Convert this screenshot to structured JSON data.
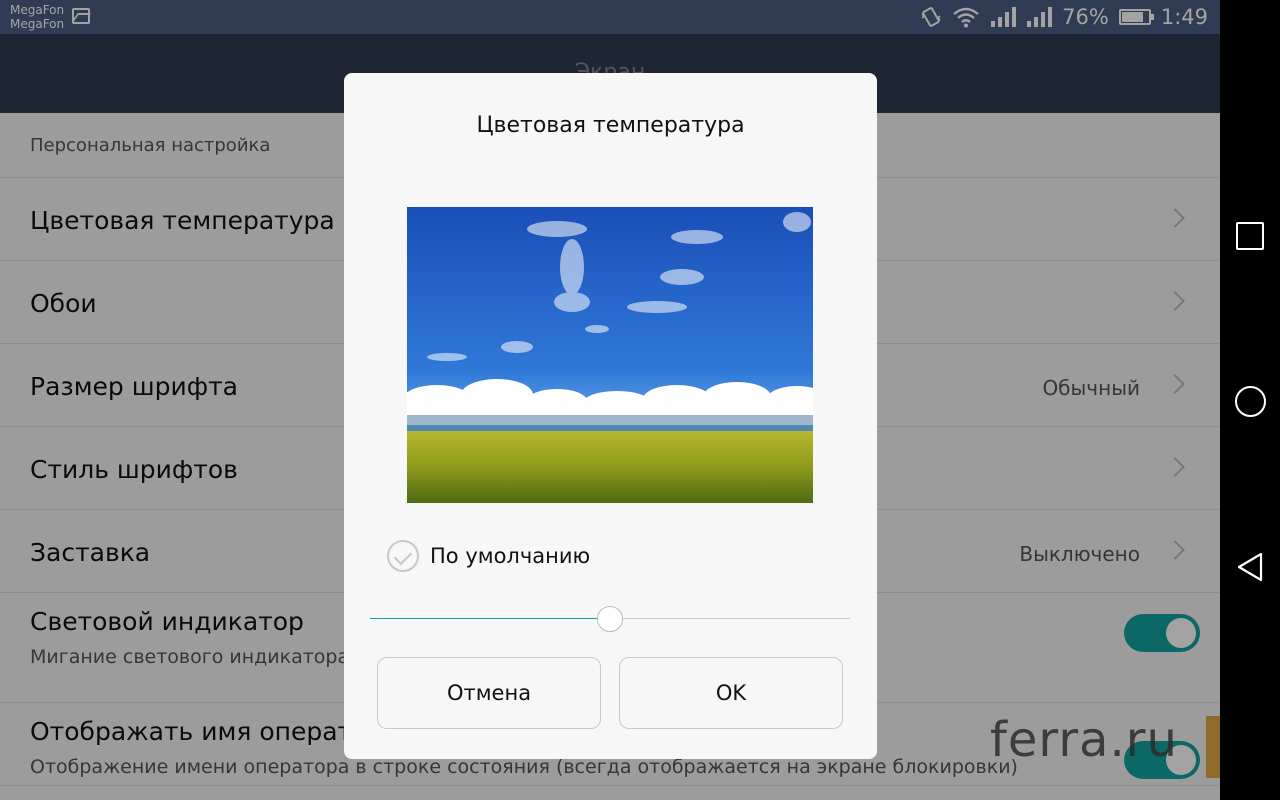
{
  "status_bar": {
    "carrier_1": "MegaFon",
    "carrier_2": "MegaFon",
    "battery": "76%",
    "time": "1:49",
    "icons": [
      "gallery-icon",
      "vibrate-icon",
      "wifi-icon",
      "signal-icon",
      "signal-icon",
      "battery-icon"
    ],
    "battery_level": 0.76
  },
  "app_bar": {
    "title": "Экран"
  },
  "settings": {
    "section_header": "Персональная настройка",
    "items": [
      {
        "title": "Цветовая температура",
        "value": ""
      },
      {
        "title": "Обои",
        "value": ""
      },
      {
        "title": "Размер шрифта",
        "value": "Обычный"
      },
      {
        "title": "Стиль шрифтов",
        "value": ""
      },
      {
        "title": "Заставка",
        "value": "Выключено"
      },
      {
        "title": "Световой индикатор",
        "subtitle": "Мигание светового индикатора",
        "toggle": true
      },
      {
        "title": "Отображать имя оператора",
        "subtitle": "Отображение имени оператора в строке состояния (всегда отображается на экране блокировки)",
        "toggle": true
      }
    ]
  },
  "dialog": {
    "title": "Цветовая температура",
    "default_label": "По умолчанию",
    "default_checked": true,
    "slider_value": 0.5,
    "cancel_label": "Отмена",
    "ok_label": "OK"
  },
  "watermark": {
    "text": "ferra.ru"
  },
  "colors": {
    "accent": "#12a3a0",
    "status_bar": "#4b5e83",
    "app_bar": "#2f3b50",
    "watermark_badge": "#e0a02a"
  }
}
